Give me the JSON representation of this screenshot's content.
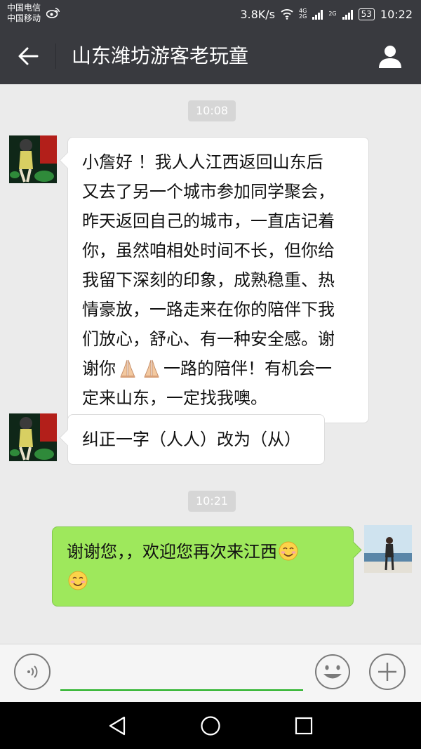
{
  "status_bar": {
    "carrier_1": "中国电信",
    "carrier_2": "中国移动",
    "speed": "3.8K/s",
    "net_top": "4G",
    "net_bottom": "2G",
    "net_2g": "2G",
    "battery": "53",
    "time": "10:22",
    "icons": [
      "weibo-icon",
      "wifi-icon",
      "signal-icon",
      "battery-icon"
    ]
  },
  "header": {
    "title": "山东潍坊游客老玩童",
    "back_icon": "arrow-left-icon",
    "profile_icon": "person-icon"
  },
  "conversation": {
    "timestamps": [
      "10:08",
      "10:21"
    ],
    "messages": [
      {
        "sender": "other",
        "lines": [
          "小詹好 ！我人人江西返回山东后",
          "又去了另一个城市参加同学聚会，",
          "昨天返回自己的城市，一直店记着",
          "你，虽然咱相处时间不长，但你给",
          "我留下深刻的印象，成熟稳重、热",
          "情豪放，一路走来在你的陪伴下我",
          "们放心，舒心、有一种安全感。谢"
        ],
        "line_8_before": "谢你",
        "line_8_emoji": "folded-hands-emoji",
        "line_8_after": "一路的陪伴！有机会一",
        "line_9": "定来山东，一定找我噢。"
      },
      {
        "sender": "other",
        "text": "纠正一字（人人）改为（从）"
      },
      {
        "sender": "me",
        "text": "谢谢您，，欢迎您再次来江西",
        "emoji": "smiling-face-emoji"
      }
    ]
  },
  "input_bar": {
    "text_value": "",
    "voice_icon": "voice-icon",
    "emoji_icon": "smiley-icon",
    "plus_icon": "plus-icon"
  },
  "nav_bar": {
    "icons": [
      "back-triangle-icon",
      "home-circle-icon",
      "recents-square-icon"
    ]
  },
  "colors": {
    "header_bg": "#393a3f",
    "chat_bg": "#ebebeb",
    "my_bubble": "#9ee85c",
    "their_bubble": "#ffffff",
    "input_accent": "#1aad19"
  }
}
